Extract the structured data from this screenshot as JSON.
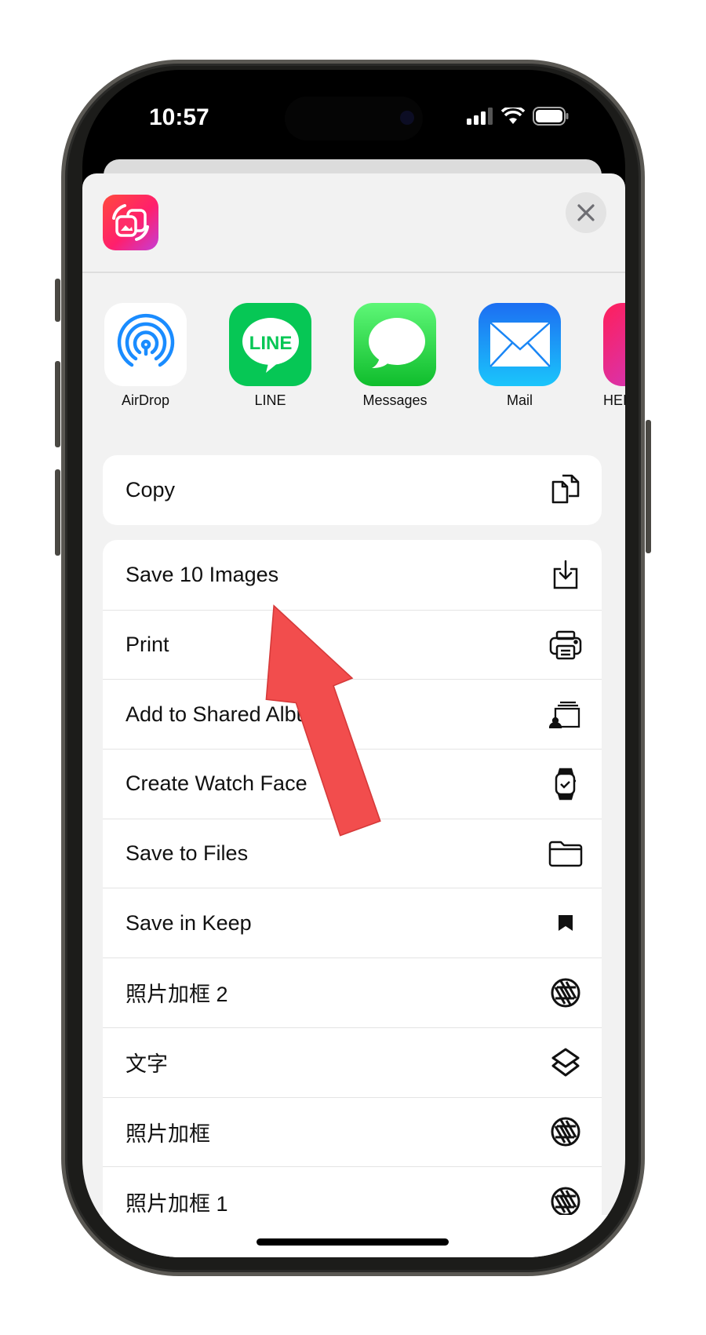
{
  "status_bar": {
    "time": "10:57",
    "icons": [
      "cellular-signal-icon",
      "wifi-icon",
      "battery-icon"
    ]
  },
  "share_sheet": {
    "app_icon": "photo-resize-app-icon",
    "close_icon": "close-icon",
    "targets": [
      {
        "label": "AirDrop",
        "icon": "airdrop-icon"
      },
      {
        "label": "LINE",
        "icon": "line-icon",
        "icon_text": "LINE"
      },
      {
        "label": "Messages",
        "icon": "messages-icon"
      },
      {
        "label": "Mail",
        "icon": "mail-icon"
      },
      {
        "label": "HEIC",
        "icon": "app-icon"
      }
    ],
    "copy_action": {
      "label": "Copy",
      "icon": "copy-icon"
    },
    "actions": [
      {
        "label": "Save 10 Images",
        "icon": "save-download-icon"
      },
      {
        "label": "Print",
        "icon": "printer-icon"
      },
      {
        "label": "Add to Shared Album",
        "icon": "shared-album-icon"
      },
      {
        "label": "Create Watch Face",
        "icon": "watch-icon"
      },
      {
        "label": "Save to Files",
        "icon": "folder-icon"
      },
      {
        "label": "Save in Keep",
        "icon": "bookmark-icon"
      },
      {
        "label": "照片加框 2",
        "icon": "aperture-icon"
      },
      {
        "label": "文字",
        "icon": "shortcuts-layers-icon"
      },
      {
        "label": "照片加框",
        "icon": "aperture-icon"
      },
      {
        "label": "照片加框 1",
        "icon": "aperture-icon"
      }
    ]
  },
  "annotation": {
    "arrow_color": "#f24d4d"
  }
}
